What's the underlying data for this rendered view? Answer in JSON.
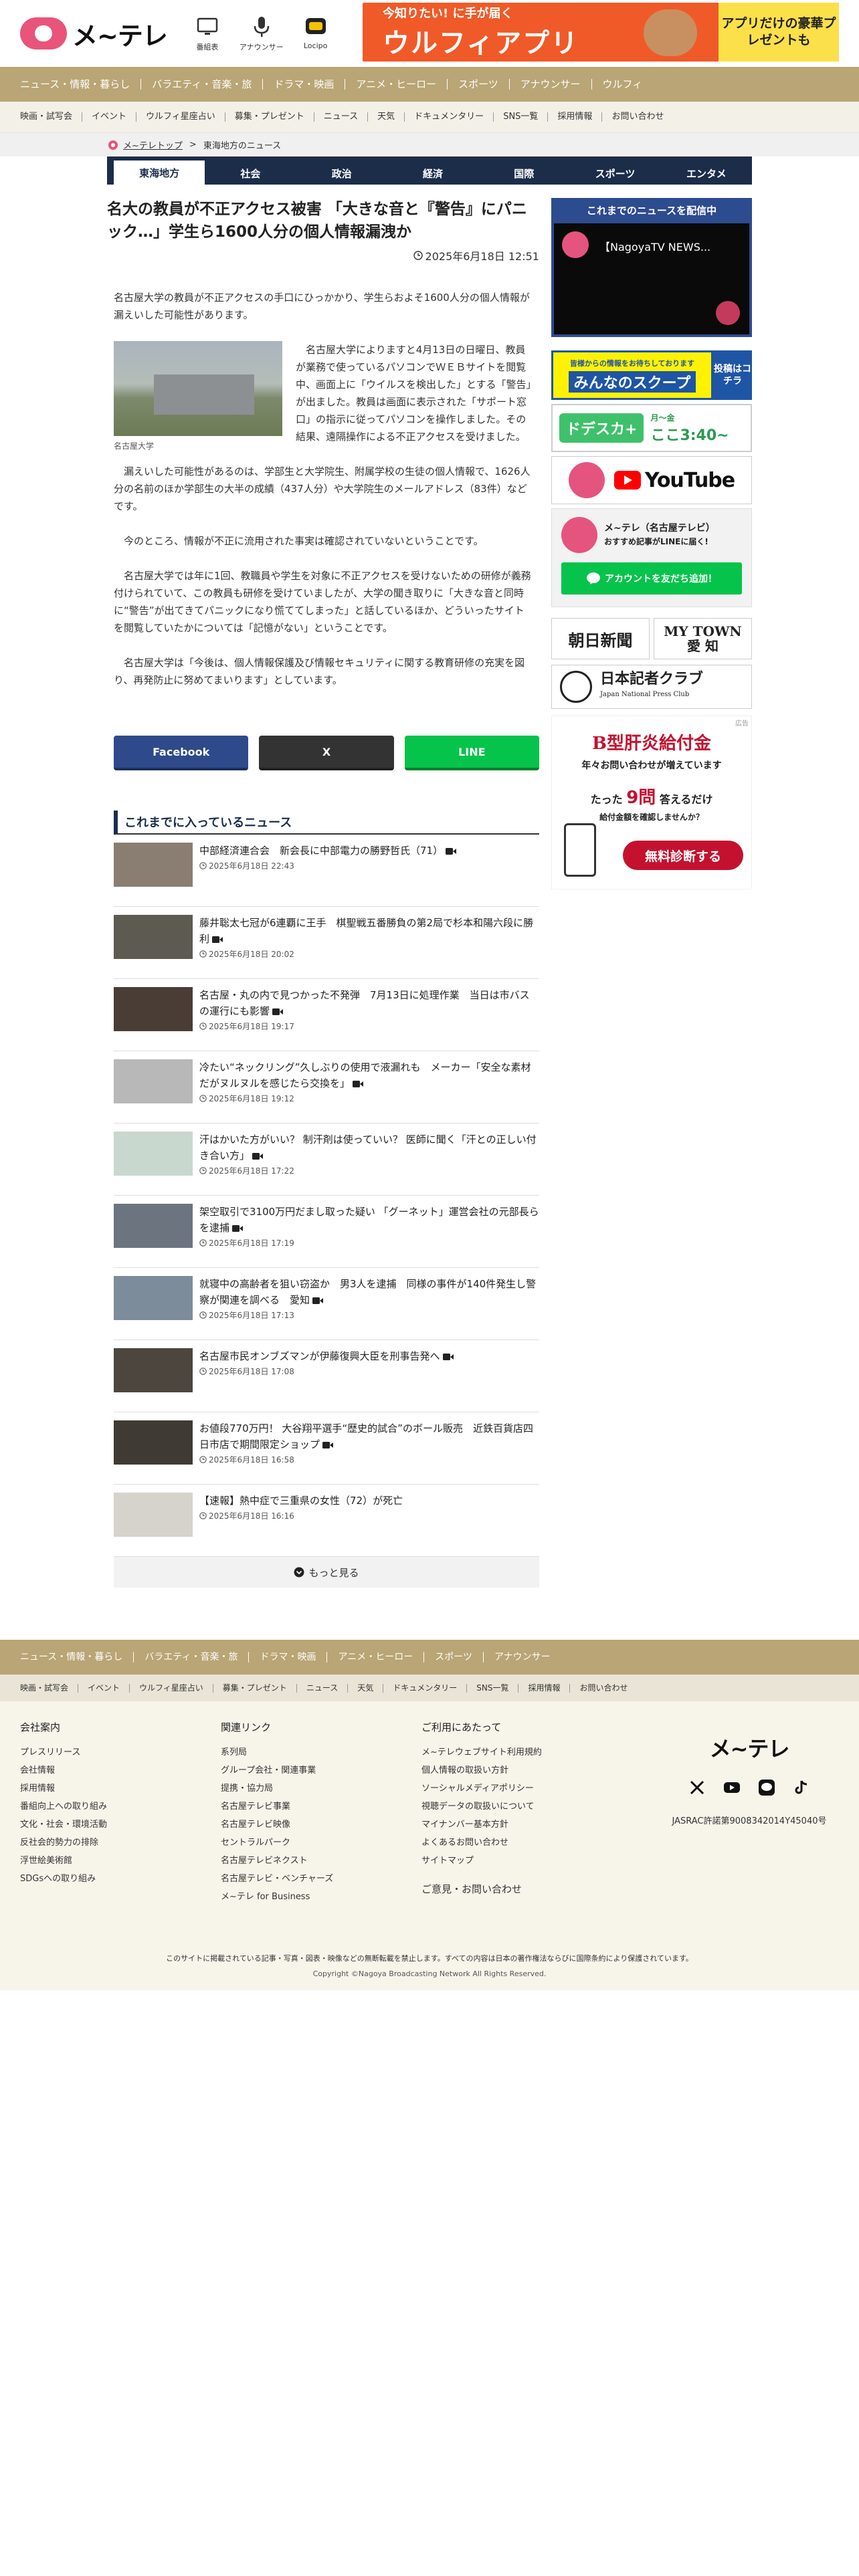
{
  "header": {
    "logo_text": "メ~テレ",
    "icons": [
      {
        "name": "tv-icon",
        "label": "番組表"
      },
      {
        "name": "microphone-icon",
        "label": "アナウンサー"
      },
      {
        "name": "locipo-icon",
        "label": "Locipo"
      }
    ],
    "banner": {
      "small": "今知りたい! に手が届く",
      "big": "ウルフィアプリ",
      "right": "アプリだけの豪華プレゼントも"
    }
  },
  "nav_primary": [
    "ニュース・情報・暮らし",
    "バラエティ・音楽・旅",
    "ドラマ・映画",
    "アニメ・ヒーロー",
    "スポーツ",
    "アナウンサー",
    "ウルフィ"
  ],
  "nav_secondary": [
    "映画・試写会",
    "イベント",
    "ウルフィ星座占い",
    "募集・プレゼント",
    "ニュース",
    "天気",
    "ドキュメンタリー",
    "SNS一覧",
    "採用情報",
    "お問い合わせ"
  ],
  "breadcrumb": {
    "home": "メ~テレトップ",
    "separator": ">",
    "current": "東海地方のニュース"
  },
  "categories": [
    "東海地方",
    "社会",
    "政治",
    "経済",
    "国際",
    "スポーツ",
    "エンタメ"
  ],
  "article": {
    "title": "名大の教員が不正アクセス被害 「大きな音と『警告』にパニック…」学生ら1600人分の個人情報漏洩か",
    "date": "2025年6月18日 12:51",
    "lead": "名古屋大学の教員が不正アクセスの手口にひっかかり、学生らおよそ1600人分の個人情報が漏えいした可能性があります。",
    "figure_caption": "名古屋大学",
    "p1": "　名古屋大学によりますと4月13日の日曜日、教員が業務で使っているパソコンでＷＥＢサイトを閲覧中、画面上に「ウイルスを検出した」とする「警告」が出ました。教員は画面に表示された「サポート窓口」の指示に従ってパソコンを操作しました。その結果、遠隔操作による不正アクセスを受けました。",
    "p2": "　漏えいした可能性があるのは、学部生と大学院生、附属学校の生徒の個人情報で、1626人分の名前のほか学部生の大半の成績（437人分）や大学院生のメールアドレス（83件）などです。",
    "p3": "　今のところ、情報が不正に流用された事実は確認されていないということです。",
    "p4": "　名古屋大学では年に1回、教職員や学生を対象に不正アクセスを受けないための研修が義務付けられていて、この教員も研修を受けていましたが、大学の聞き取りに「大きな音と同時に“警告”が出てきてパニックになり慌ててしまった」と話しているほか、どういったサイトを閲覧していたかについては「記憶がない」ということです。",
    "p5": "　名古屋大学は「今後は、個人情報保護及び情報セキュリティに関する教育研修の充実を図り、再発防止に努めてまいります」としています。"
  },
  "share": {
    "facebook": "Facebook",
    "x": "X",
    "line": "LINE"
  },
  "news": {
    "heading": "これまでに入っているニュース",
    "items": [
      {
        "title": "中部経済連合会　新会長に中部電力の勝野哲氏（71）",
        "date": "2025年6月18日 22:43",
        "video": true,
        "thumb": "#8a7d72"
      },
      {
        "title": "藤井聡太七冠が6連覇に王手　棋聖戦五番勝負の第2局で杉本和陽六段に勝利",
        "date": "2025年6月18日 20:02",
        "video": true,
        "thumb": "#5d5a52"
      },
      {
        "title": "名古屋・丸の内で見つかった不発弾　7月13日に処理作業　当日は市バスの運行にも影響",
        "date": "2025年6月18日 19:17",
        "video": true,
        "thumb": "#4a3d35"
      },
      {
        "title": "冷たい“ネックリング”久しぶりの使用で液漏れも　メーカー「安全な素材だがヌルヌルを感じたら交換を」",
        "date": "2025年6月18日 19:12",
        "video": true,
        "thumb": "#b8b8b8"
      },
      {
        "title": "汗はかいた方がいい？ 制汗剤は使っていい？ 医師に聞く「汗との正しい付き合い方」",
        "date": "2025年6月18日 17:22",
        "video": true,
        "thumb": "#c8d8cf"
      },
      {
        "title": "架空取引で3100万円だまし取った疑い 「グーネット」運営会社の元部長らを逮捕",
        "date": "2025年6月18日 17:19",
        "video": true,
        "thumb": "#6c7480"
      },
      {
        "title": "就寝中の高齢者を狙い窃盗か　男3人を逮捕　同様の事件が140件発生し警察が関連を調べる　愛知",
        "date": "2025年6月18日 17:13",
        "video": true,
        "thumb": "#7d8c9a"
      },
      {
        "title": "名古屋市民オンブズマンが伊藤復興大臣を刑事告発へ",
        "date": "2025年6月18日 17:08",
        "video": true,
        "thumb": "#4c463f"
      },
      {
        "title": "お値段770万円！ 大谷翔平選手“歴史的試合”のボール販売　近鉄百貨店四日市店で期間限定ショップ",
        "date": "2025年6月18日 16:58",
        "video": true,
        "thumb": "#3f3a33"
      },
      {
        "title": "【速報】熱中症で三重県の女性（72）が死亡",
        "date": "2025年6月18日 16:16",
        "video": false,
        "thumb": "#d6d2cc"
      }
    ],
    "more": "もっと見る"
  },
  "sidebar": {
    "live_heading": "これまでのニュースを配信中",
    "live_title": "【NagoyaTV NEWS...",
    "scoop_small": "皆様からの情報をお待ちしております",
    "scoop_big": "みんなのスクープ",
    "scoop_side": "投稿はコチラ",
    "dtv_logo": "ドデスカ+",
    "dtv_days": "月～金",
    "dtv_time": "ここ3:40~",
    "youtube": "YouTube",
    "line_title": "メ~テレ（名古屋テレビ）",
    "line_sub": "おすすめ記事がLINEに届く!",
    "line_btn": "アカウントを友だち追加！",
    "paper1": "朝日新聞",
    "paper2_top": "MY TOWN",
    "paper2_bottom": "愛 知",
    "club": "日本記者クラブ",
    "club_en": "Japan National Press Club",
    "ad": {
      "label": "広告",
      "title": "B型肝炎給付金",
      "sub": "年々お問い合わせが増えています",
      "mid_pre": "たった",
      "mid_num": "9問",
      "mid_post": "答えるだけ",
      "small": "給付金額を確認しませんか？",
      "btn": "無料診断する"
    }
  },
  "footer": {
    "nav_primary": [
      "ニュース・情報・暮らし",
      "バラエティ・音楽・旅",
      "ドラマ・映画",
      "アニメ・ヒーロー",
      "スポーツ",
      "アナウンサー"
    ],
    "nav_secondary": [
      "映画・試写会",
      "イベント",
      "ウルフィ星座占い",
      "募集・プレゼント",
      "ニュース",
      "天気",
      "ドキュメンタリー",
      "SNS一覧",
      "採用情報",
      "お問い合わせ"
    ],
    "col1": {
      "heading": "会社案内",
      "links": [
        "プレスリリース",
        "会社情報",
        "採用情報",
        "番組向上への取り組み",
        "文化・社会・環境活動",
        "反社会的勢力の排除",
        "浮世絵美術館",
        "SDGsへの取り組み"
      ]
    },
    "col2": {
      "heading": "関連リンク",
      "links": [
        "系列局",
        "グループ会社・関連事業",
        "提携・協力局",
        "名古屋テレビ事業",
        "名古屋テレビ映像",
        "セントラルパーク",
        "名古屋テレビネクスト",
        "名古屋テレビ・ベンチャーズ",
        "メ~テレ for Business"
      ]
    },
    "col3": {
      "heading": "ご利用にあたって",
      "links": [
        "メ~テレウェブサイト利用規約",
        "個人情報の取扱い方針",
        "ソーシャルメディアポリシー",
        "視聴データの取扱いについて",
        "マイナンバー基本方針",
        "よくあるお問い合わせ",
        "サイトマップ"
      ],
      "contact": "ご意見・お問い合わせ"
    },
    "brand": "メ~テレ",
    "jasrac": "JASRAC許諾第9008342014Y45040号",
    "notice": "このサイトに掲載されている記事・写真・図表・映像などの無断転載を禁止します。すべての内容は日本の著作権法ならびに国際条約により保護されています。",
    "copyright": "Copyright ©Nagoya Broadcasting Network All Rights Reserved."
  }
}
